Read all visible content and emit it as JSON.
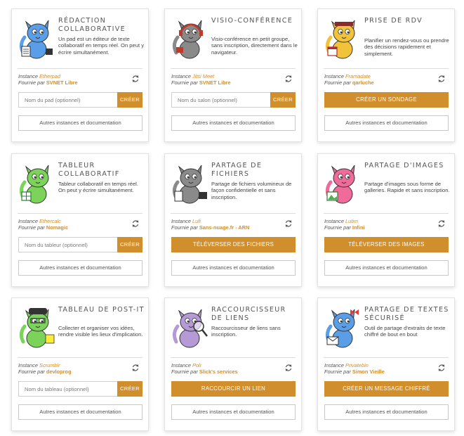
{
  "accent_color": "#d18e2c",
  "instance_prefix": "Instance",
  "provider_prefix": "Fournie par",
  "cards": [
    {
      "title": "Rédaction collaborative",
      "description": "Un pad est un éditeur de texte collaboratif en temps réel. On peut y écrire simultanément.",
      "instance": "Etherpad",
      "provider": "SVNET Libre",
      "input_placeholder": "Nom du pad (optionnel)",
      "button": "CRÉER",
      "more": "Autres instances et documentation",
      "mascot_color": "#5b9ee8",
      "mascot_icon": "notepad-cat-icon"
    },
    {
      "title": "Visio-conférence",
      "description": "Visio-conférence en petit groupe, sans inscription, directement dans le navigateur.",
      "instance": "Jitsi Meet",
      "provider": "SVNET Libre",
      "input_placeholder": "Nom du salon (optionnel)",
      "button": "CRÉER",
      "more": "Autres instances et documentation",
      "mascot_color": "#8a8a8a",
      "mascot_icon": "headphones-cat-icon"
    },
    {
      "title": "Prise de RDV",
      "description": "Planifier un rendez-vous ou prendre des décisions rapidement et simplement.",
      "instance": "Framadate",
      "provider": "qarluche",
      "button": "CRÉER UN SONDAGE",
      "more": "Autres instances et documentation",
      "mascot_color": "#f0c33a",
      "mascot_icon": "calendar-cat-icon"
    },
    {
      "title": "Tableur collaboratif",
      "description": "Tableur collaboratif en temps réel. On peut y écrire simultanément.",
      "instance": "Ethercalc",
      "provider": "Nomagic",
      "input_placeholder": "Nom du tableur (optionnel)",
      "button": "CRÉER",
      "more": "Autres instances et documentation",
      "mascot_color": "#7cd35a",
      "mascot_icon": "spreadsheet-cat-icon"
    },
    {
      "title": "Partage de fichiers",
      "description": "Partage de fichiers volumineux de façon confidentielle et sans inscription.",
      "instance": "Lufi",
      "provider": "Sans-nuage.fr - ARN",
      "button": "TÉLÉVERSER DES FICHIERS",
      "more": "Autres instances et documentation",
      "mascot_color": "#8a8a8a",
      "mascot_icon": "file-cat-icon"
    },
    {
      "title": "Partage d'images",
      "description": "Partage d'images sous forme de galleries. Rapide et sans inscription.",
      "instance": "Lutim",
      "provider": "Infini",
      "button": "TÉLÉVERSER DES IMAGES",
      "more": "Autres instances et documentation",
      "mascot_color": "#f06a9a",
      "mascot_icon": "image-cat-icon"
    },
    {
      "title": "Tableau de post-it",
      "description": "Collecter et organiser vos idées, rendre visible les lieux d'implication.",
      "instance": "Scrumblr",
      "provider": "devloprog",
      "input_placeholder": "Nom du tableau (optionnel)",
      "button": "CRÉER",
      "more": "Autres instances et documentation",
      "mascot_color": "#7cd35a",
      "mascot_icon": "post-it-cat-icon"
    },
    {
      "title": "Raccourcisseur de liens",
      "description": "Raccourcisseur de liens sans inscription.",
      "instance": "Polr",
      "provider": "Slick's services",
      "button": "RACCOURCIR UN LIEN",
      "more": "Autres instances et documentation",
      "mascot_color": "#b59ad6",
      "mascot_icon": "magnifier-cat-icon"
    },
    {
      "title": "Partage de textes sécurisé",
      "description": "Outil de partage d'extraits de texte chiffré de bout en bout",
      "instance": "Privatebin",
      "provider": "Simon Vieille",
      "button": "CRÉER UN MESSAGE CHIFFRÉ",
      "more": "Autres instances et documentation",
      "mascot_color": "#5b9ee8",
      "mascot_icon": "envelope-cat-icon"
    }
  ]
}
